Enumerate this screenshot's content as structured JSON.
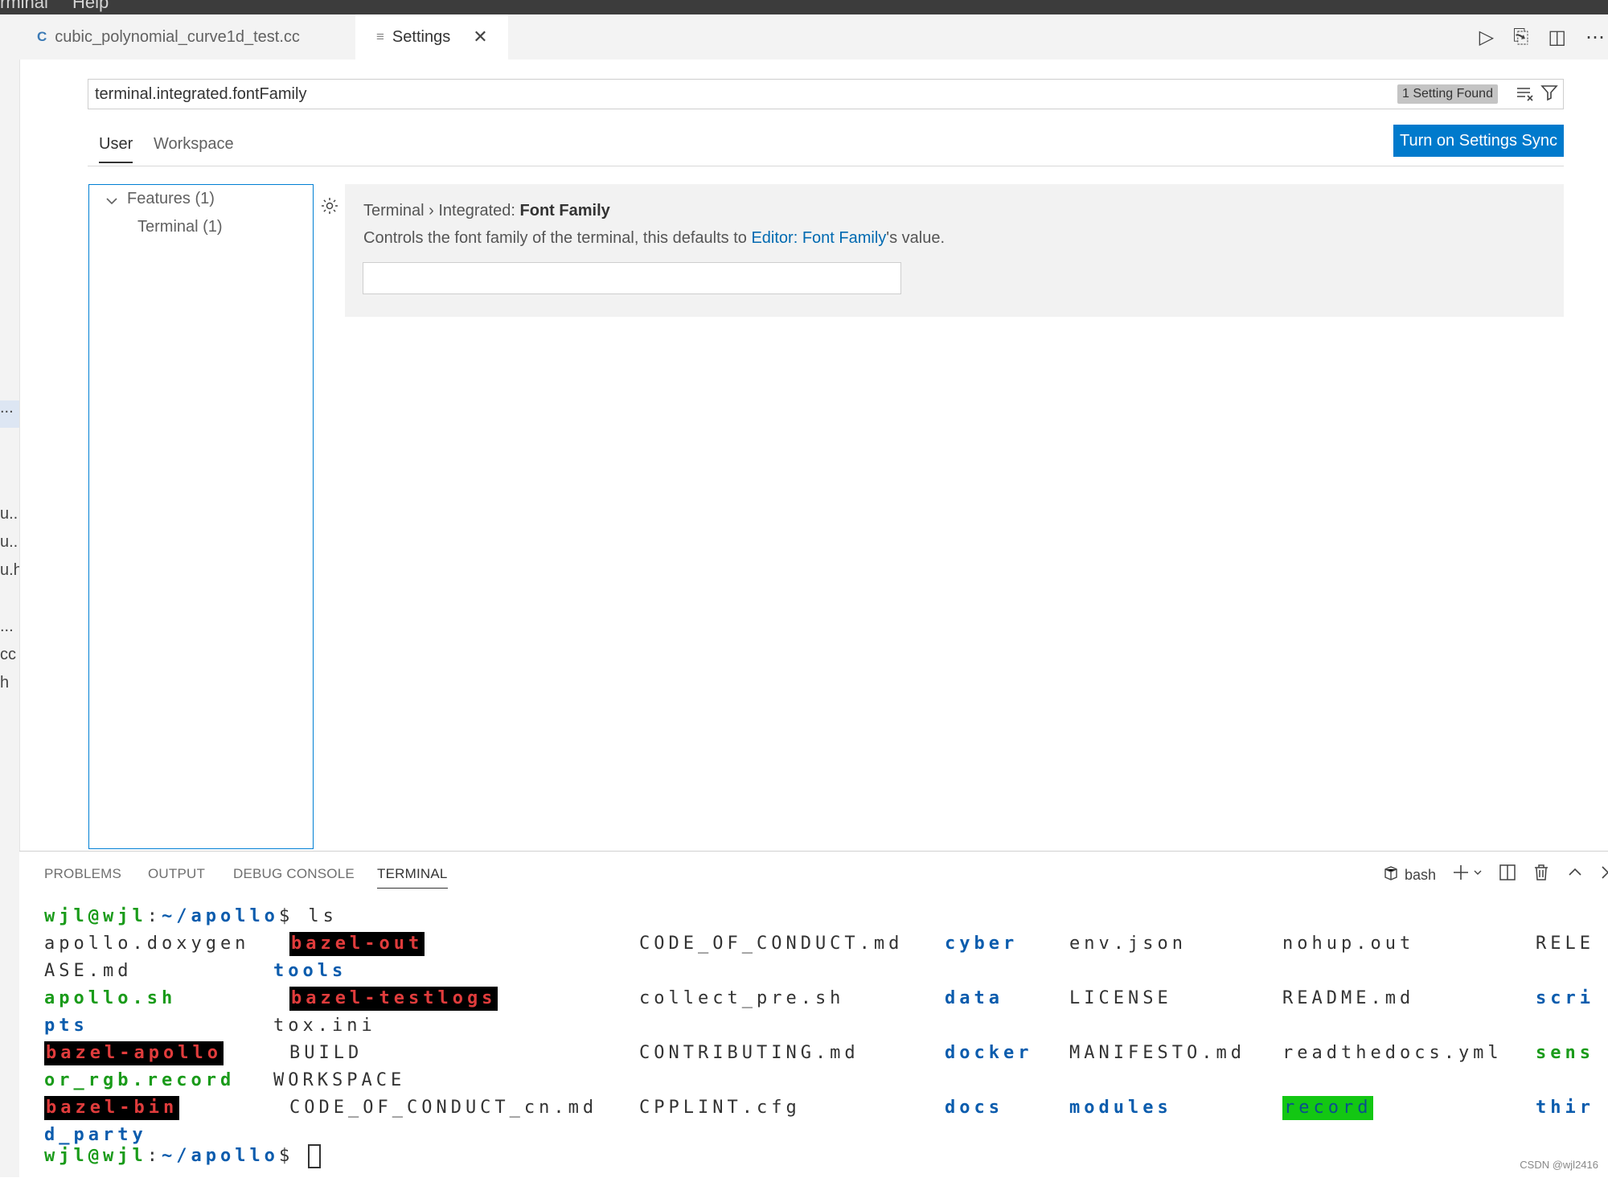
{
  "menubar": {
    "items": [
      "rminal",
      "Help"
    ]
  },
  "activity_fragments": [
    "...",
    "u...",
    "u...",
    "u.h",
    "...",
    "cc",
    "h"
  ],
  "tabs": [
    {
      "icon": "C",
      "label": "cubic_polynomial_curve1d_test.cc"
    },
    {
      "icon": "≡",
      "label": "Settings",
      "close": "✕"
    }
  ],
  "editor_actions": [
    "▷",
    "⎘",
    "◫",
    "⋯"
  ],
  "search": {
    "value": "terminal.integrated.fontFamily",
    "badge": "1 Setting Found"
  },
  "settings_tabs": [
    "User",
    "Workspace"
  ],
  "sync_button": "Turn on Settings Sync",
  "toc": {
    "features": "Features (1)",
    "terminal": "Terminal (1)"
  },
  "setting": {
    "category": "Terminal › Integrated: ",
    "name": "Font Family",
    "desc_before": "Controls the font family of the terminal, this defaults to ",
    "desc_link": "Editor: Font Family",
    "desc_after": "'s value.",
    "value": ""
  },
  "panel": {
    "tabs": [
      "PROBLEMS",
      "OUTPUT",
      "DEBUG CONSOLE",
      "TERMINAL"
    ],
    "shell": "bash"
  },
  "terminal": {
    "prompt_user": "wjl@wjl",
    "prompt_sep": ":",
    "prompt_path": "~/apollo",
    "prompt_dollar": "$",
    "command": " ls",
    "rows": [
      [
        {
          "t": "apollo.doxygen",
          "s": ""
        },
        {
          "t": "bazel-out",
          "s": "r"
        },
        {
          "t": "CODE_OF_CONDUCT.md",
          "s": ""
        },
        {
          "t": "cyber",
          "s": "b"
        },
        {
          "t": "env.json",
          "s": ""
        },
        {
          "t": "nohup.out",
          "s": ""
        },
        {
          "t": "RELE",
          "s": ""
        }
      ],
      [
        {
          "t": "ASE.md",
          "s": ""
        },
        {
          "t": "tools",
          "s": "b"
        }
      ],
      [
        {
          "t": "apollo.sh",
          "s": "g"
        },
        {
          "t": "bazel-testlogs",
          "s": "r"
        },
        {
          "t": "collect_pre.sh",
          "s": ""
        },
        {
          "t": "data",
          "s": "b"
        },
        {
          "t": "LICENSE",
          "s": ""
        },
        {
          "t": "README.md",
          "s": ""
        },
        {
          "t": "scri",
          "s": "b"
        }
      ],
      [
        {
          "t": "pts",
          "s": "b"
        },
        {
          "t": "tox.ini",
          "s": ""
        }
      ],
      [
        {
          "t": "bazel-apollo",
          "s": "r"
        },
        {
          "t": "BUILD",
          "s": ""
        },
        {
          "t": "CONTRIBUTING.md",
          "s": ""
        },
        {
          "t": "docker",
          "s": "b"
        },
        {
          "t": "MANIFESTO.md",
          "s": ""
        },
        {
          "t": "readthedocs.yml",
          "s": ""
        },
        {
          "t": "sens",
          "s": "g"
        }
      ],
      [
        {
          "t": "or_rgb.record",
          "s": "g"
        },
        {
          "t": "WORKSPACE",
          "s": ""
        }
      ],
      [
        {
          "t": "bazel-bin",
          "s": "r"
        },
        {
          "t": "CODE_OF_CONDUCT_cn.md",
          "s": ""
        },
        {
          "t": "CPPLINT.cfg",
          "s": ""
        },
        {
          "t": "docs",
          "s": "b"
        },
        {
          "t": "modules",
          "s": "b"
        },
        {
          "t": "record",
          "s": "gb"
        },
        {
          "t": "thir",
          "s": "b"
        }
      ],
      [
        {
          "t": "d_party",
          "s": "b"
        }
      ]
    ]
  },
  "watermark": "CSDN @wjl2416"
}
